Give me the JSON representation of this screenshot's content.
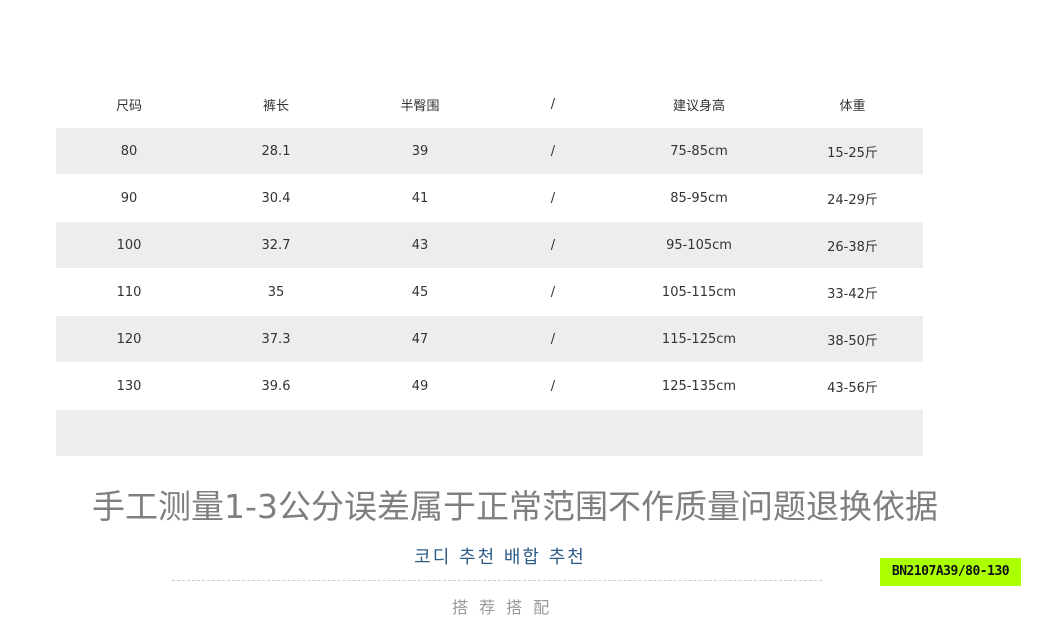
{
  "size_table": {
    "headers": [
      "尺码",
      "裤长",
      "半臀围",
      "/",
      "建议身高",
      "体重"
    ],
    "rows": [
      [
        "80",
        "28.1",
        "39",
        "/",
        "75-85cm",
        "15-25斤"
      ],
      [
        "90",
        "30.4",
        "41",
        "/",
        "85-95cm",
        "24-29斤"
      ],
      [
        "100",
        "32.7",
        "43",
        "/",
        "95-105cm",
        "26-38斤"
      ],
      [
        "110",
        "35",
        "45",
        "/",
        "105-115cm",
        "33-42斤"
      ],
      [
        "120",
        "37.3",
        "47",
        "/",
        "115-125cm",
        "38-50斤"
      ],
      [
        "130",
        "39.6",
        "49",
        "/",
        "125-135cm",
        "43-56斤"
      ]
    ]
  },
  "measurement_note": "手工测量1-3公分误差属于正常范围不作质量问题退换依据",
  "recommendation_heading": "코디 추천 배합 추천",
  "cut_off_text": "搭 荐 搭 配",
  "sku_badge": "BN2107A39/80-130",
  "colors": {
    "row_shade": "#ededed",
    "note_text": "#7f7f7f",
    "heading_text": "#2e5d87",
    "badge_bg": "#aaff00"
  }
}
